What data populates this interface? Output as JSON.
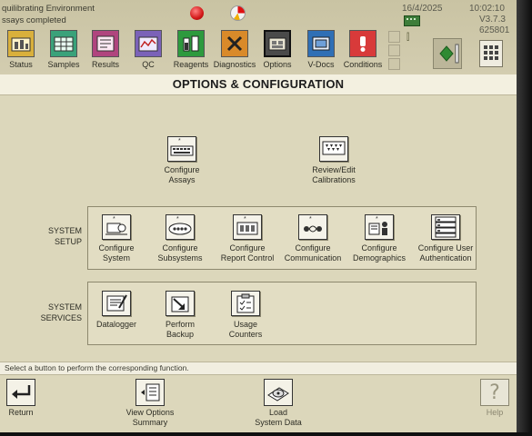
{
  "status": {
    "line1": "quilibrating Environment",
    "line2": "ssays completed",
    "date": "16/4/2025",
    "time": "10:02:10",
    "version": "V3.7.3",
    "serial": "625801"
  },
  "nav": [
    {
      "label": "Status",
      "icon": "status-icon",
      "color": "#d9b03c"
    },
    {
      "label": "Samples",
      "icon": "samples-icon",
      "color": "#3aa27a"
    },
    {
      "label": "Results",
      "icon": "results-icon",
      "color": "#b0457e"
    },
    {
      "label": "QC",
      "icon": "qc-icon",
      "color": "#7b62b8"
    },
    {
      "label": "Reagents",
      "icon": "reagents-icon",
      "color": "#2e9a3e"
    },
    {
      "label": "Diagnostics",
      "icon": "diagnostics-icon",
      "color": "#d98a2a"
    },
    {
      "label": "Options",
      "icon": "options-icon",
      "color": "#4a4a4a"
    },
    {
      "label": "V-Docs",
      "icon": "vdocs-icon",
      "color": "#2f6fb5"
    },
    {
      "label": "Conditions",
      "icon": "conditions-icon",
      "color": "#d83a3a"
    }
  ],
  "page": {
    "title": "OPTIONS & CONFIGURATION"
  },
  "top_tiles": [
    {
      "label": "Configure\nAssays",
      "icon": "configure-assays-icon"
    },
    {
      "label": "Review/Edit\nCalibrations",
      "icon": "calibrations-icon"
    }
  ],
  "system_setup": {
    "label": "SYSTEM\nSETUP",
    "items": [
      {
        "label": "Configure\nSystem",
        "icon": "configure-system-icon"
      },
      {
        "label": "Configure\nSubsystems",
        "icon": "configure-subsystems-icon"
      },
      {
        "label": "Configure\nReport Control",
        "icon": "report-control-icon"
      },
      {
        "label": "Configure\nCommunication",
        "icon": "communication-icon"
      },
      {
        "label": "Configure\nDemographics",
        "icon": "demographics-icon"
      },
      {
        "label": "Configure User\nAuthentication",
        "icon": "user-authentication-icon"
      }
    ]
  },
  "system_services": {
    "label": "SYSTEM\nSERVICES",
    "items": [
      {
        "label": "Datalogger",
        "icon": "datalogger-icon"
      },
      {
        "label": "Perform\nBackup",
        "icon": "backup-icon"
      },
      {
        "label": "Usage\nCounters",
        "icon": "usage-counters-icon"
      }
    ]
  },
  "status_message": "Select a button to perform the corresponding function.",
  "bottom": [
    {
      "label": "Return",
      "icon": "return-icon"
    },
    {
      "label": "View Options\nSummary",
      "icon": "view-summary-icon"
    },
    {
      "label": "Load\nSystem Data",
      "icon": "load-data-icon"
    },
    {
      "label": "Help",
      "icon": "help-icon"
    }
  ],
  "colors": {
    "screen_bg": "#dcd7bb",
    "title_strip": "#f3f0e0",
    "green_indicator": "#3a8a3a"
  }
}
